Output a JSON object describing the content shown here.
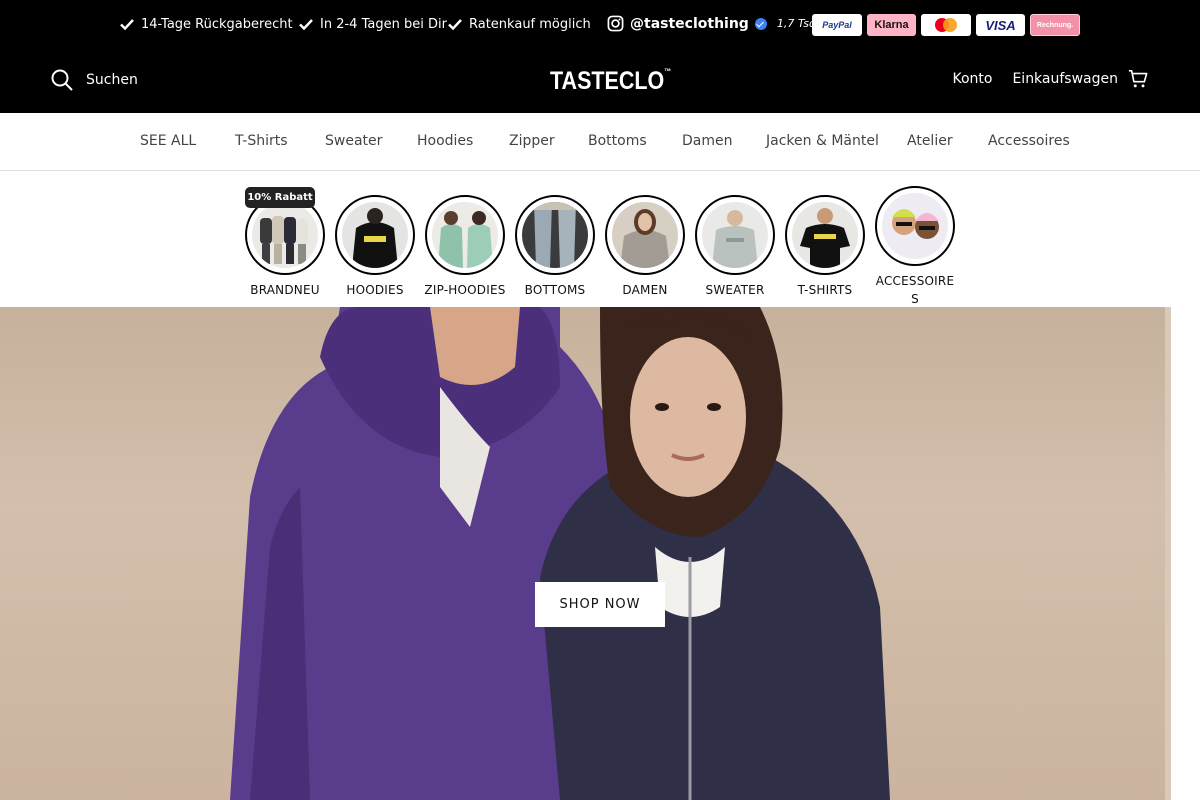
{
  "announcement": {
    "usps": [
      {
        "text": "14-Tage Rückgaberecht"
      },
      {
        "text": "In 2-4 Tagen bei Dir"
      },
      {
        "text": "Ratenkauf möglich"
      }
    ],
    "instagram": {
      "handle": "@tasteclothing",
      "followers": "1,7 Tsd."
    },
    "payments": {
      "paypal": "PayPal",
      "klarna": "Klarna",
      "mastercard": "",
      "visa": "VISA",
      "rechnung": "Rechnung."
    }
  },
  "header": {
    "search_label": "Suchen",
    "logo": "TASTECLO",
    "logo_tm": "™",
    "account_label": "Konto",
    "cart_label": "Einkaufswagen"
  },
  "nav": {
    "items": [
      "SEE ALL",
      "T-Shirts",
      "Sweater",
      "Hoodies",
      "Zipper",
      "Bottoms",
      "Damen",
      "Jacken & Mäntel",
      "Atelier",
      "Accessoires"
    ]
  },
  "stories": {
    "badge": "10% Rabatt",
    "items": [
      {
        "label": "BRANDNEU"
      },
      {
        "label": "HOODIES"
      },
      {
        "label": "ZIP-HOODIES"
      },
      {
        "label": "BOTTOMS"
      },
      {
        "label": "DAMEN"
      },
      {
        "label": "SWEATER"
      },
      {
        "label": "T-SHIRTS"
      },
      {
        "label": "ACCESSOIRES"
      }
    ]
  },
  "hero": {
    "cta_label": "SHOP NOW"
  },
  "colors": {
    "bar": "#000000",
    "hero_bg": "#cdb8a5",
    "purple_hoodie": "#5a3c8c",
    "navy_hoodie": "#2f3048"
  }
}
